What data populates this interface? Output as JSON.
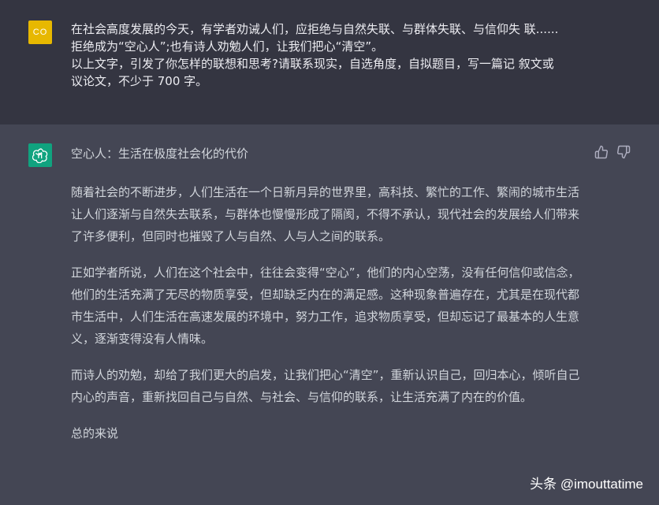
{
  "user_message": {
    "avatar_text": "CO",
    "lines": [
      "在社会高度发展的今天，有学者劝诫人们，应拒绝与自然失联、与群体失联、与信仰失 联......",
      "拒绝成为“空心人”;也有诗人劝勉人们，让我们把心“清空”。",
      "以上文字，引发了你怎样的联想和思考?请联系现实，自选角度，自拟题目，写一篇记 叙文或",
      "议论文，不少于 700 字。"
    ]
  },
  "assistant_message": {
    "title": "空心人：生活在极度社会化的代价",
    "paragraphs": [
      "随着社会的不断进步，人们生活在一个日新月异的世界里，高科技、繁忙的工作、繁闹的城市生活让人们逐渐与自然失去联系，与群体也慢慢形成了隔阂，不得不承认，现代社会的发展给人们带来了许多便利，但同时也摧毁了人与自然、人与人之间的联系。",
      "正如学者所说，人们在这个社会中，往往会变得“空心”，他们的内心空荡，没有任何信仰或信念，他们的生活充满了无尽的物质享受，但却缺乏内在的满足感。这种现象普遍存在，尤其是在现代都市生活中，人们生活在高速发展的环境中，努力工作，追求物质享受，但却忘记了最基本的人生意义，逐渐变得没有人情味。",
      "而诗人的劝勉，却给了我们更大的启发，让我们把心“清空”，重新认识自己，回归本心，倾听自己内心的声音，重新找回自己与自然、与社会、与信仰的联系，让生活充满了内在的价值。",
      "总的来说"
    ]
  },
  "watermark": "头条 @imouttatime",
  "colors": {
    "user_bg": "#343541",
    "assistant_bg": "#444654",
    "user_avatar": "#e7b800",
    "bot_avatar": "#10a37f"
  },
  "icons": {
    "bot_avatar": "openai-logo-icon",
    "feedback_up": "thumbs-up-icon",
    "feedback_down": "thumbs-down-icon"
  }
}
